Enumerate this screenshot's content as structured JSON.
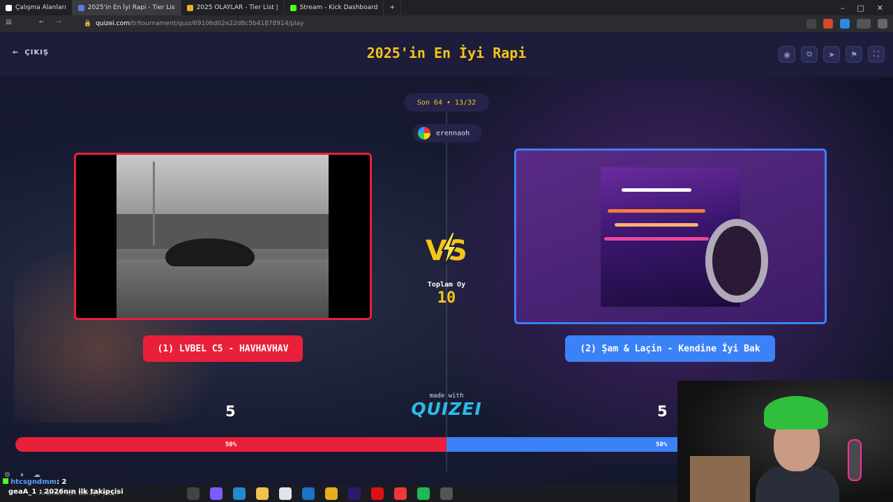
{
  "browser": {
    "workspace_label": "Çalışma Alanları",
    "tabs": [
      {
        "label": "2025'in En İyi Rapi - Tier Lis",
        "active": true
      },
      {
        "label": "2025 OLAYLAR - Tier List |"
      },
      {
        "label": "Stream - Kick Dashboard"
      }
    ],
    "url_host": "quizei.com",
    "url_path": "/tr/tournament/quiz/69106d02e22d8c5b41878914/play"
  },
  "header": {
    "exit_label": "ÇIKIŞ",
    "title": "2025'in En İyi Rapi",
    "icons": [
      "eye-icon",
      "copy-icon",
      "send-icon",
      "flag-icon",
      "fullscreen-icon"
    ]
  },
  "round_badge": "Son 64 • 13/32",
  "username": "erennaoh",
  "left": {
    "label": "(1) LVBEL C5 - HAVHAVHAV",
    "score": "5",
    "percent": "50%",
    "color": "#e8203a"
  },
  "right": {
    "label": "(2) Şam & Laçin - Kendine İyi Bak",
    "score": "5",
    "percent": "50%",
    "color": "#3b82f6"
  },
  "total_votes_label": "Toplam Oy",
  "total_votes_value": "10",
  "made_with": "made with",
  "brand_logo": "QUIZEI",
  "stream_overlay": {
    "chat_user": "htcsgndmm",
    "chat_text": ": 2",
    "follower_text": "geaA_1 : 2026nın ilk takipçisi"
  },
  "taskbar": {
    "search_placeholder": "Aramak için buraya yazın"
  }
}
